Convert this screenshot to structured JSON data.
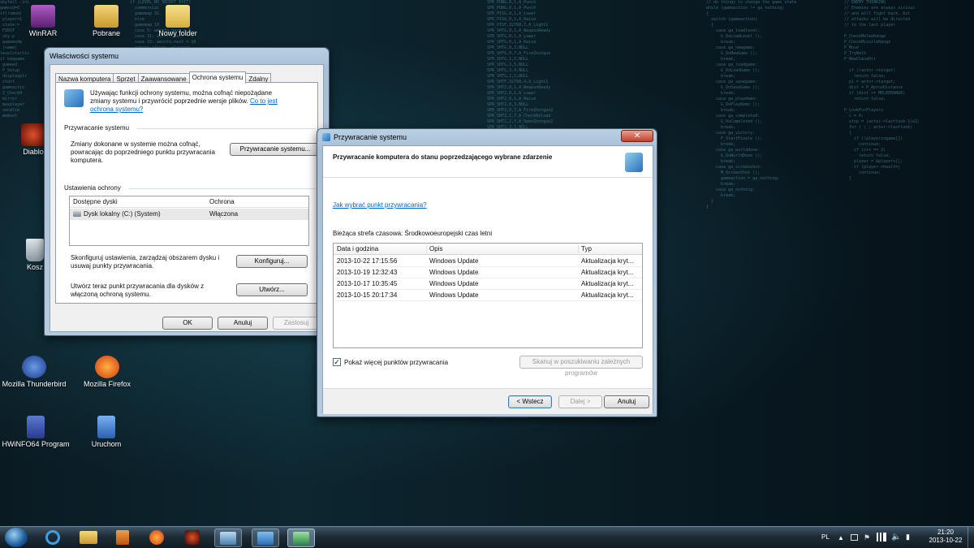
{
  "desktop": {
    "icons": [
      {
        "label": "WinRAR",
        "color": "#7a3b8f"
      },
      {
        "label": "Pobrane",
        "color": "#d9b54a"
      },
      {
        "label": "Nowy folder",
        "color": "#e6c75a"
      },
      {
        "label": "Diablo",
        "color": "#8b2a1a"
      },
      {
        "label": "Kosz",
        "color": "#9aa7b0"
      },
      {
        "label": "Mozilla Thunderbird",
        "color": "#2a5aa8"
      },
      {
        "label": "Mozilla Firefox",
        "color": "#e66a1a"
      },
      {
        "label": "HWiNFO64 Program",
        "color": "#3a5ab0"
      },
      {
        "label": "Uruchom",
        "color": "#3a7ad0"
      }
    ]
  },
  "sysprops": {
    "title": "Właściwości systemu",
    "tabs": [
      "Nazwa komputera",
      "Sprzęt",
      "Zaawansowane",
      "Ochrona systemu",
      "Zdalny"
    ],
    "intro_text": "Używając funkcji ochrony systemu, można cofnąć niepożądane zmiany systemu i przywrócić poprzednie wersje plików.",
    "intro_link": "Co to jest ochrona systemu?",
    "restore_section": "Przywracanie systemu",
    "restore_desc": "Zmiany dokonane w systemie można cofnąć, powracając do poprzedniego punktu przywracania komputera.",
    "restore_button": "Przywracanie systemu...",
    "protection_section": "Ustawienia ochrony",
    "col_drives": "Dostępne dyski",
    "col_protection": "Ochrona",
    "drive_name": "Dysk lokalny (C:) (System)",
    "drive_status": "Włączona",
    "configure_desc": "Skonfiguruj ustawienia, zarządzaj obszarem dysku i usuwaj punkty przywracania.",
    "configure_button": "Konfiguruj...",
    "create_desc": "Utwórz teraz punkt przywracania dla dysków z włączoną ochroną systemu.",
    "create_button": "Utwórz...",
    "ok": "OK",
    "cancel": "Anuluj",
    "apply": "Zastosuj"
  },
  "restore": {
    "title": "Przywracanie systemu",
    "heading": "Przywracanie komputera do stanu poprzedzającego wybrane zdarzenie",
    "help_link": "Jak wybrać punkt przywracania?",
    "timezone": "Bieżąca strefa czasowa: Środkowoeuropejski czas letni",
    "columns": [
      "Data i godzina",
      "Opis",
      "Typ"
    ],
    "rows": [
      [
        "2013-10-22 17:15:56",
        "Windows Update",
        "Aktualizacja kryt..."
      ],
      [
        "2013-10-19 12:32:43",
        "Windows Update",
        "Aktualizacja kryt..."
      ],
      [
        "2013-10-17 10:35:45",
        "Windows Update",
        "Aktualizacja kryt..."
      ],
      [
        "2013-10-15 20:17:34",
        "Windows Update",
        "Aktualizacja kryt..."
      ]
    ],
    "show_more": "Pokaż więcej punktów przywracania",
    "scan_button": "Skanuj w poszukiwaniu zależnych programów",
    "back": "< Wstecz",
    "next": "Dalej >",
    "cancel": "Anuluj"
  },
  "taskbar": {
    "lang": "PL",
    "time": "21:20",
    "date": "2013-10-22"
  }
}
